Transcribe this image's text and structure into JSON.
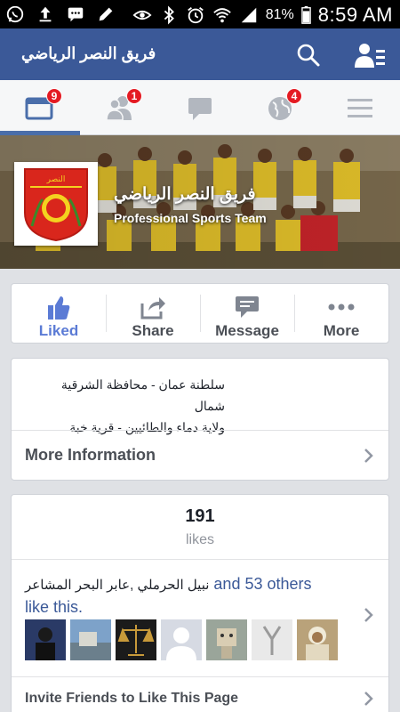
{
  "status_bar": {
    "left_icons": [
      "whatsapp-icon",
      "upload-icon",
      "messages-icon",
      "edit-icon"
    ],
    "right_icons": [
      "eye-icon",
      "bluetooth-icon",
      "alarm-icon",
      "wifi-icon",
      "signal-icon"
    ],
    "battery": "81%",
    "time": "8:59 AM"
  },
  "header": {
    "title": "فريق النصر الرياضي",
    "accent_color": "#3b5998"
  },
  "tabs": [
    {
      "icon": "news-feed-icon",
      "badge": "9",
      "active": true
    },
    {
      "icon": "friend-requests-icon",
      "badge": "1",
      "active": false
    },
    {
      "icon": "messages-icon",
      "badge": "",
      "active": false
    },
    {
      "icon": "notifications-globe-icon",
      "badge": "4",
      "active": false
    },
    {
      "icon": "menu-icon",
      "badge": "",
      "active": false
    }
  ],
  "page": {
    "name": "فريق النصر الرياضي",
    "category": "Professional Sports Team"
  },
  "actions": [
    {
      "label": "Liked",
      "icon": "thumbs-up-icon",
      "active": true
    },
    {
      "label": "Share",
      "icon": "share-icon",
      "active": false
    },
    {
      "label": "Message",
      "icon": "message-icon",
      "active": false
    },
    {
      "label": "More",
      "icon": "more-dots-icon",
      "active": false
    }
  ],
  "about": {
    "line1": "سلطنة عمان - محافظة الشرقية شمال",
    "line2": "ولاية دماء والطائيين - قرية خبة",
    "more_label": "More Information"
  },
  "likes": {
    "count": "191",
    "label": "likes",
    "friends_names": "نبيل الحرملي ,عابر البحر المشاعر",
    "friends_rest": " and 53 others",
    "friends_tail": "like this.",
    "invite_label": "Invite Friends to Like This Page"
  }
}
